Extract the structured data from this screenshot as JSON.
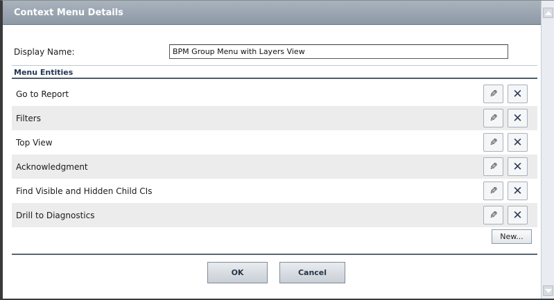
{
  "window": {
    "title": "Context Menu Details"
  },
  "form": {
    "display_name_label": "Display Name:",
    "display_name_value": "BPM Group Menu with Layers View"
  },
  "section": {
    "title": "Menu Entities"
  },
  "entities": [
    {
      "label": "Go to Report"
    },
    {
      "label": "Filters"
    },
    {
      "label": "Top View"
    },
    {
      "label": "Acknowledgment"
    },
    {
      "label": "Find Visible and Hidden Child CIs"
    },
    {
      "label": "Drill to Diagnostics"
    }
  ],
  "buttons": {
    "new_label": "New...",
    "ok_label": "OK",
    "cancel_label": "Cancel"
  },
  "icons": {
    "edit": "pencil-icon",
    "delete": "close-icon",
    "scroll_up": "triangle-up-icon",
    "scroll_down": "triangle-down-icon"
  },
  "colors": {
    "titlebar": "#9aa4b0",
    "section_rule": "#4d5a68",
    "alt_row": "#ececec",
    "delete_x": "#2b3b55"
  }
}
